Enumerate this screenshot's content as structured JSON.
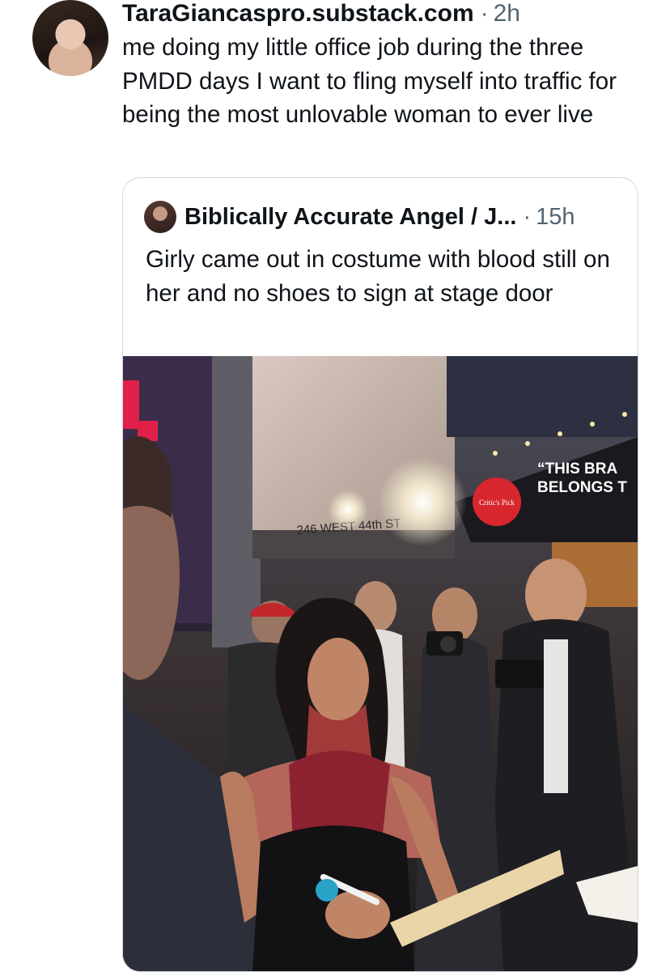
{
  "tweet": {
    "author": "TaraGiancaspro.substack.com",
    "separator": "·",
    "time": "2h",
    "text": "me doing my little office job during the three PMDD days I want to fling myself into traffic for being the most unlovable woman to ever live",
    "avatar_icon": "user-avatar"
  },
  "quoted": {
    "author": "Biblically Accurate Angel / J...",
    "separator": "·",
    "time": "15h",
    "text": "Girly came out in costume with blood still on her and no shoes to sign at stage door",
    "avatar_icon": "user-avatar"
  },
  "photo": {
    "sign_text_1": "“THIS BRA",
    "sign_text_2": "BELONGS T",
    "critics_pick": "Critic's Pick",
    "address": "246 WEST 44th ST"
  }
}
